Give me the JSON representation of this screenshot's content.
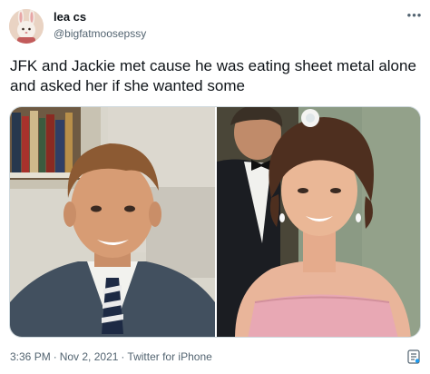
{
  "user": {
    "display_name": "lea cs",
    "handle": "@bigfatmoosepssy",
    "avatar_icon": "bunny-avatar-icon"
  },
  "more_icon": "more-options-icon",
  "more_glyph": "•••",
  "tweet": {
    "text": "JFK and Jackie met cause he was eating sheet metal alone and asked her if she wanted some"
  },
  "media": {
    "left_photo": "photo-of-smiling-man-in-suit-and-tie",
    "right_photo": "photo-of-smiling-woman-in-pink-strapless-dress"
  },
  "footer": {
    "time": "3:36 PM",
    "separator": "·",
    "date": "Nov 2, 2021",
    "client": "Twitter for iPhone",
    "analytics_icon": "analytics-icon"
  },
  "colors": {
    "text_primary": "#0f1419",
    "text_secondary": "#536471",
    "border": "#cfd9de",
    "analytics_accent": "#1d9bf0"
  }
}
